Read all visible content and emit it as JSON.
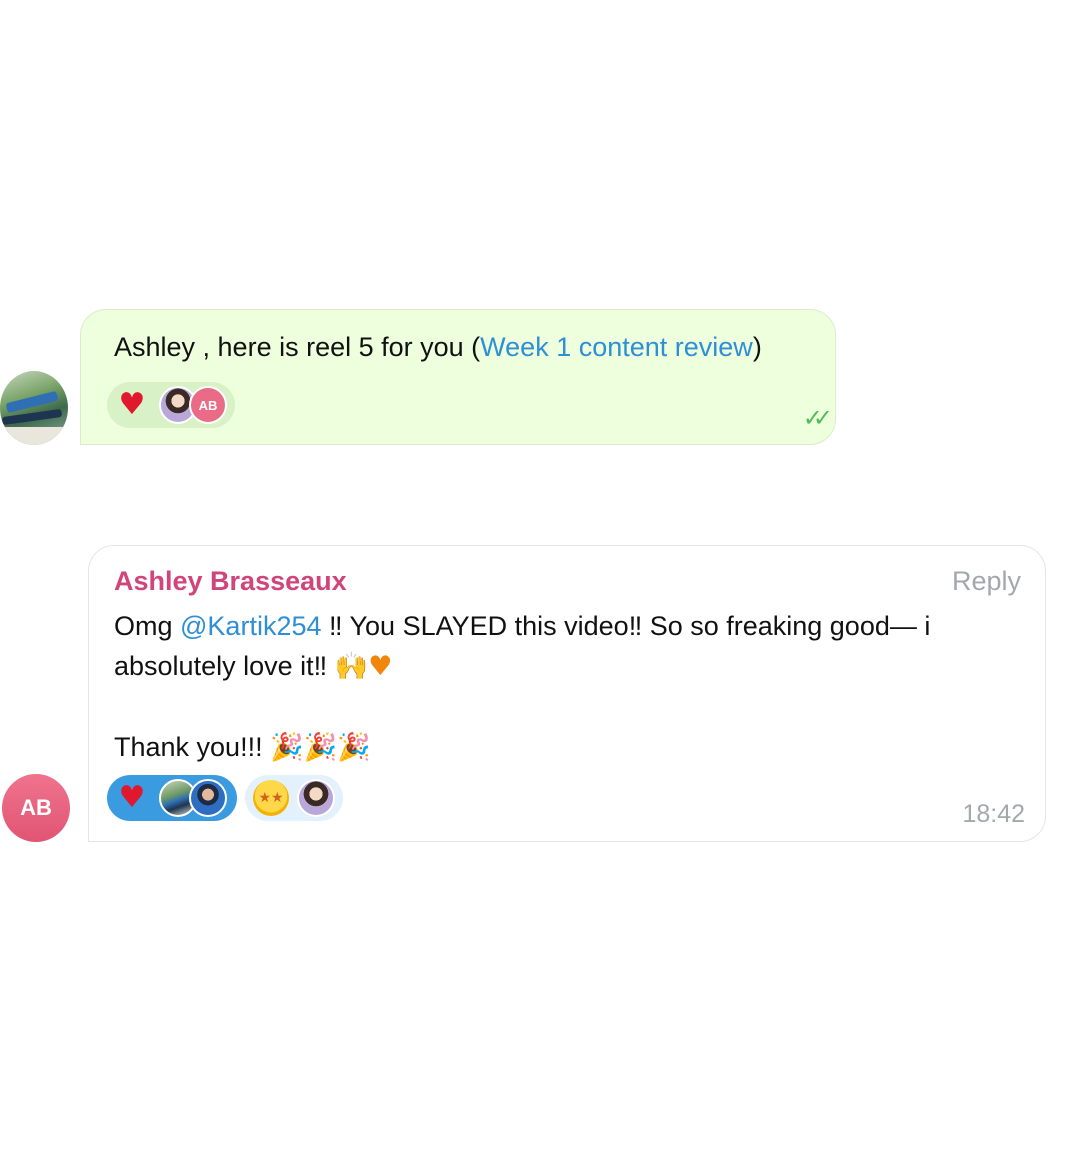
{
  "outgoing_message": {
    "text_prefix": "Ashley , here is reel 5 for you (",
    "link_text": "Week 1 content review",
    "text_suffix": ")",
    "status": "read",
    "reactions": [
      {
        "emoji": "heart",
        "avatars": [
          "woman-photo",
          "AB"
        ]
      }
    ],
    "reaction_avatar_initials": "AB"
  },
  "incoming_message": {
    "sender_name": "Ashley Brasseaux",
    "sender_initials": "AB",
    "reply_label": "Reply",
    "line1_prefix": "Omg ",
    "mention": "@Kartik254",
    "line1_suffix": " ‼ You SLAYED this video‼ So so freaking good— i",
    "line2": "absolutely love it‼ ",
    "line3": "Thank you!!! ",
    "time": "18:42",
    "reactions": [
      {
        "emoji": "heart",
        "avatars": [
          "scene-photo",
          "man-photo"
        ],
        "chosen": true
      },
      {
        "emoji": "star-struck",
        "avatars": [
          "woman-photo"
        ],
        "chosen": false
      }
    ]
  },
  "colors": {
    "outgoing_bubble": "#eeffde",
    "link": "#2e8fd6",
    "sender_name": "#d0457c",
    "read_check": "#4fbf55",
    "avatar_ab": "#e05573"
  }
}
